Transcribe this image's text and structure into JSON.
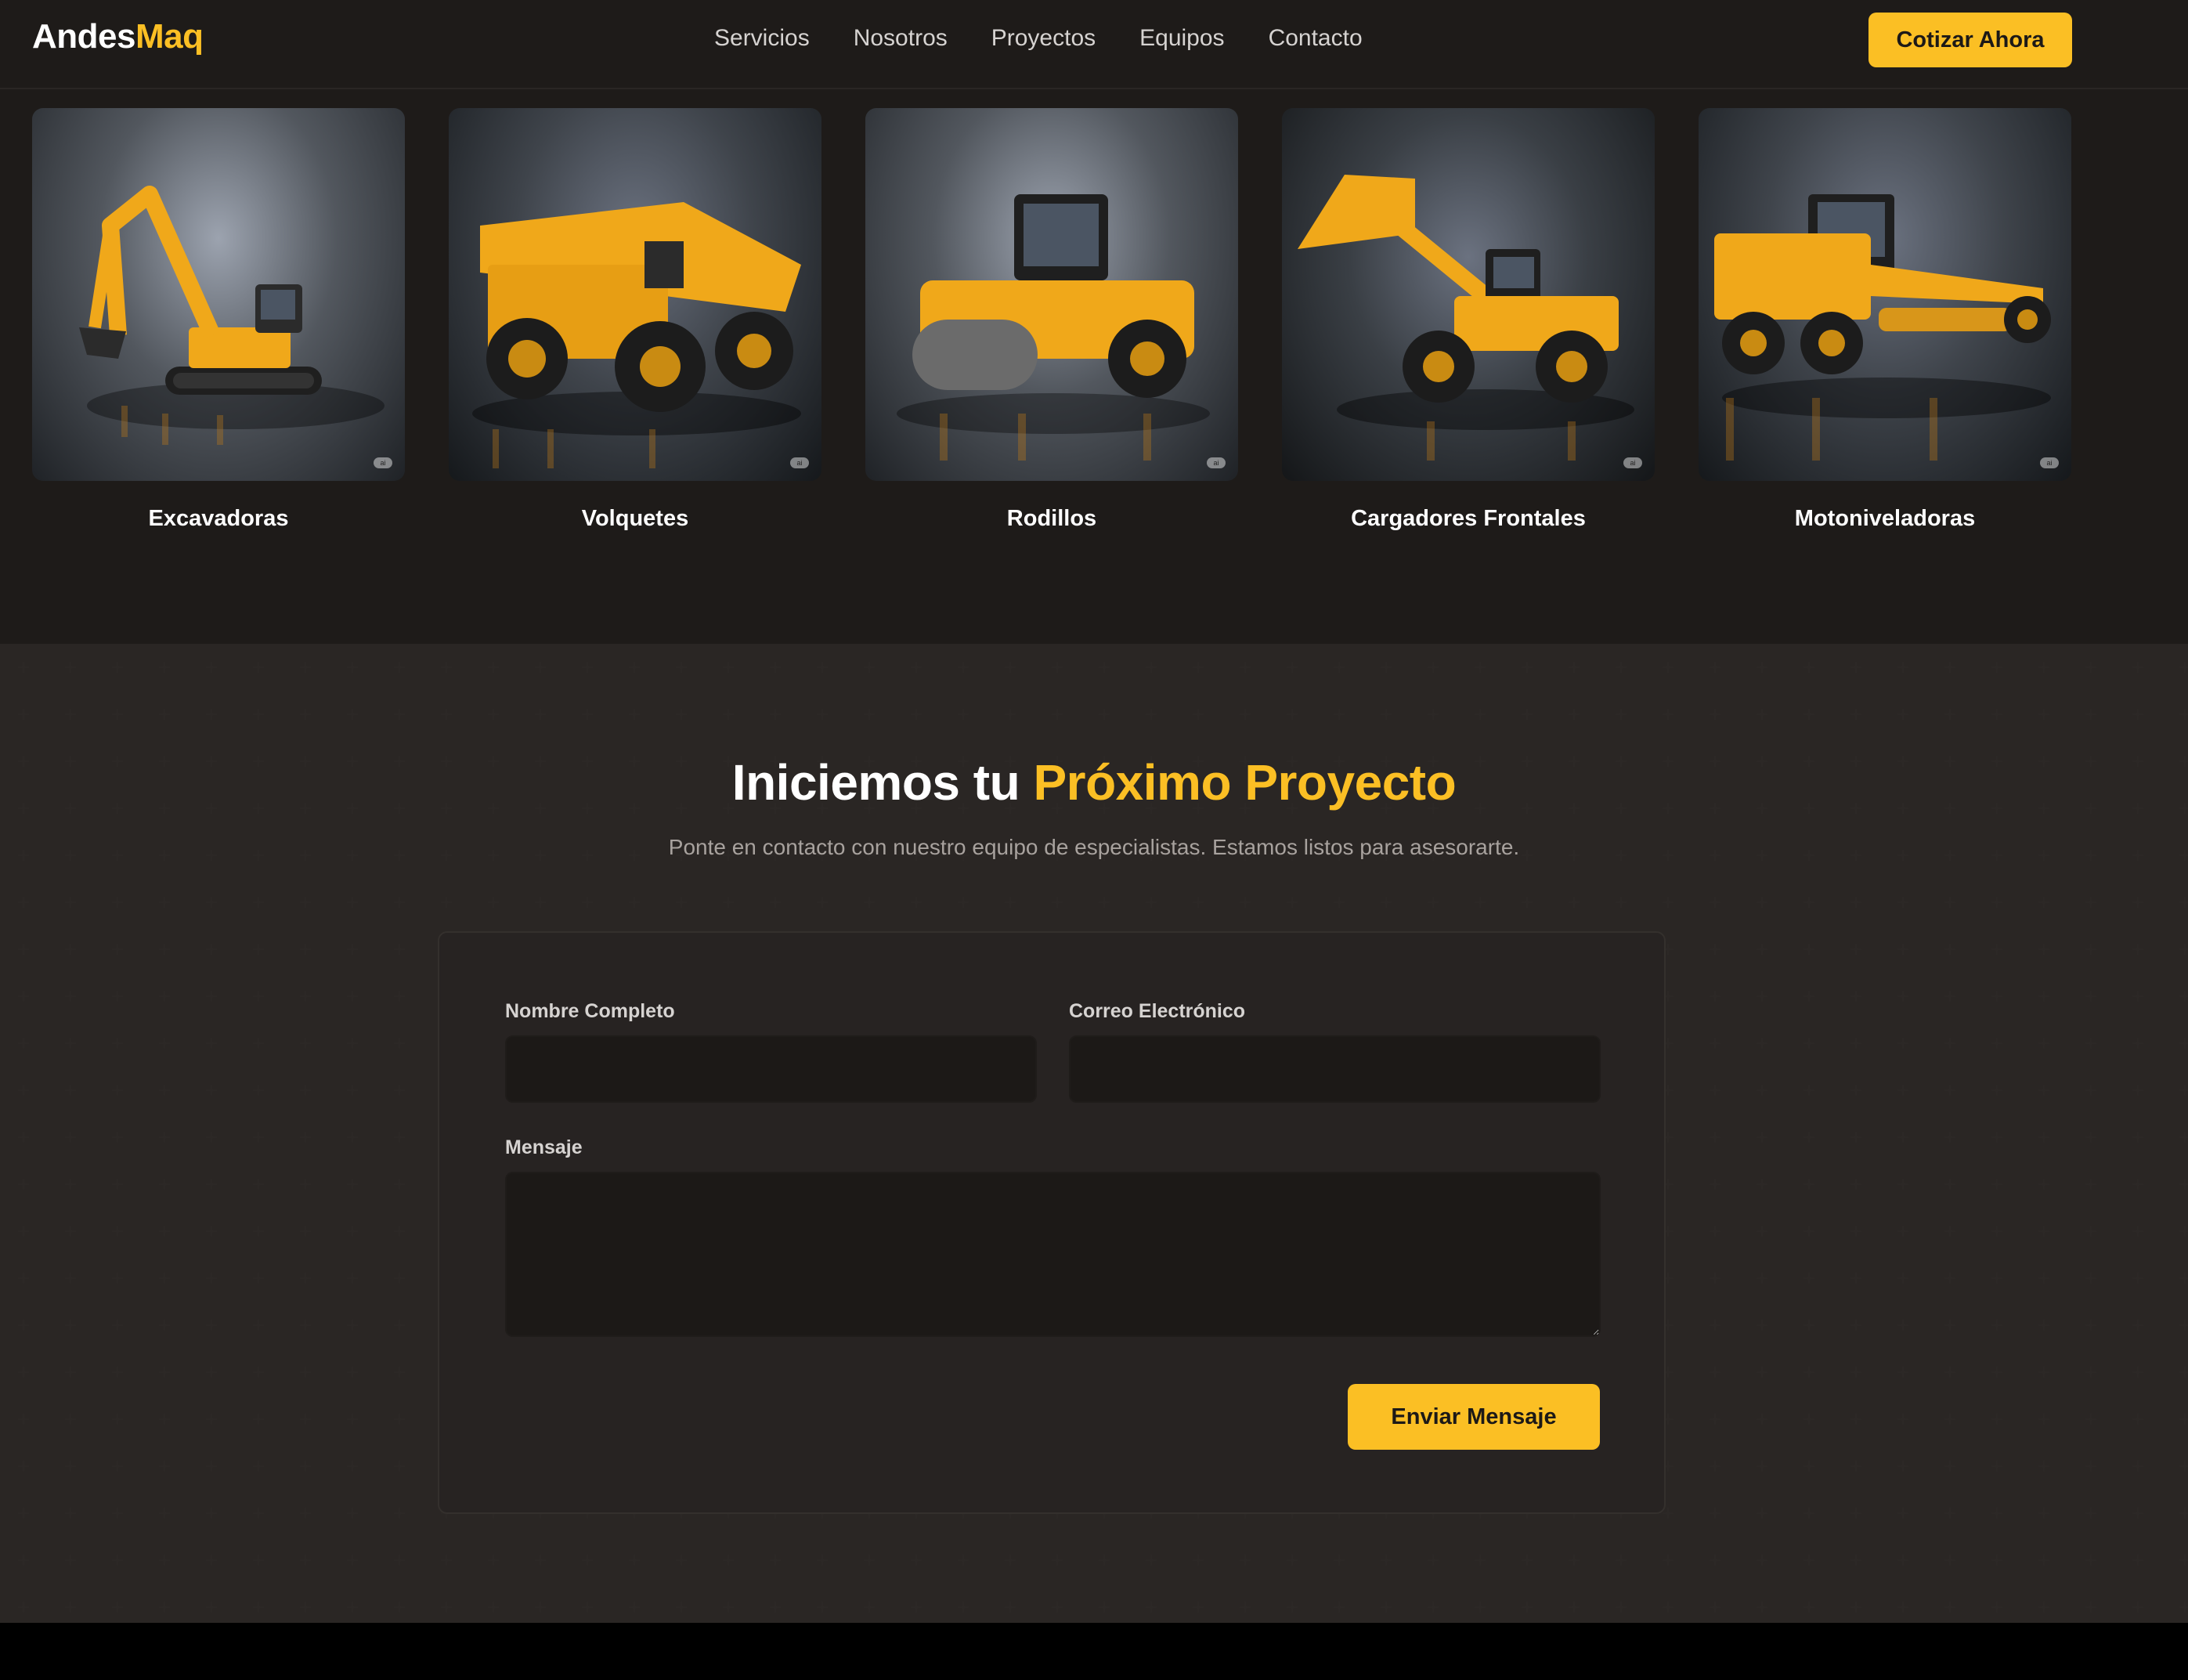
{
  "brand": {
    "part1": "Andes",
    "part2": "Maq",
    "accent": "#fbbf24"
  },
  "nav": [
    "Servicios",
    "Nosotros",
    "Proyectos",
    "Equipos",
    "Contacto"
  ],
  "header_cta": "Cotizar Ahora",
  "equipment": [
    {
      "label": "Excavadoras",
      "icon": "excavator-image"
    },
    {
      "label": "Volquetes",
      "icon": "dump-truck-image"
    },
    {
      "label": "Rodillos",
      "icon": "road-roller-image"
    },
    {
      "label": "Cargadores Frontales",
      "icon": "wheel-loader-image"
    },
    {
      "label": "Motoniveladoras",
      "icon": "motor-grader-image"
    }
  ],
  "ai_badge": "ai",
  "contact": {
    "title_a": "Iniciemos tu ",
    "title_b": "Próximo Proyecto",
    "subtitle": "Ponte en contacto con nuestro equipo de especialistas. Estamos listos para asesorarte.",
    "name_label": "Nombre Completo",
    "name_value": "",
    "email_label": "Correo Electrónico",
    "email_value": "",
    "message_label": "Mensaje",
    "message_value": "",
    "submit": "Enviar Mensaje"
  },
  "colors": {
    "background": "#1e1b19",
    "card": "#272322",
    "accent": "#fbbf24"
  }
}
